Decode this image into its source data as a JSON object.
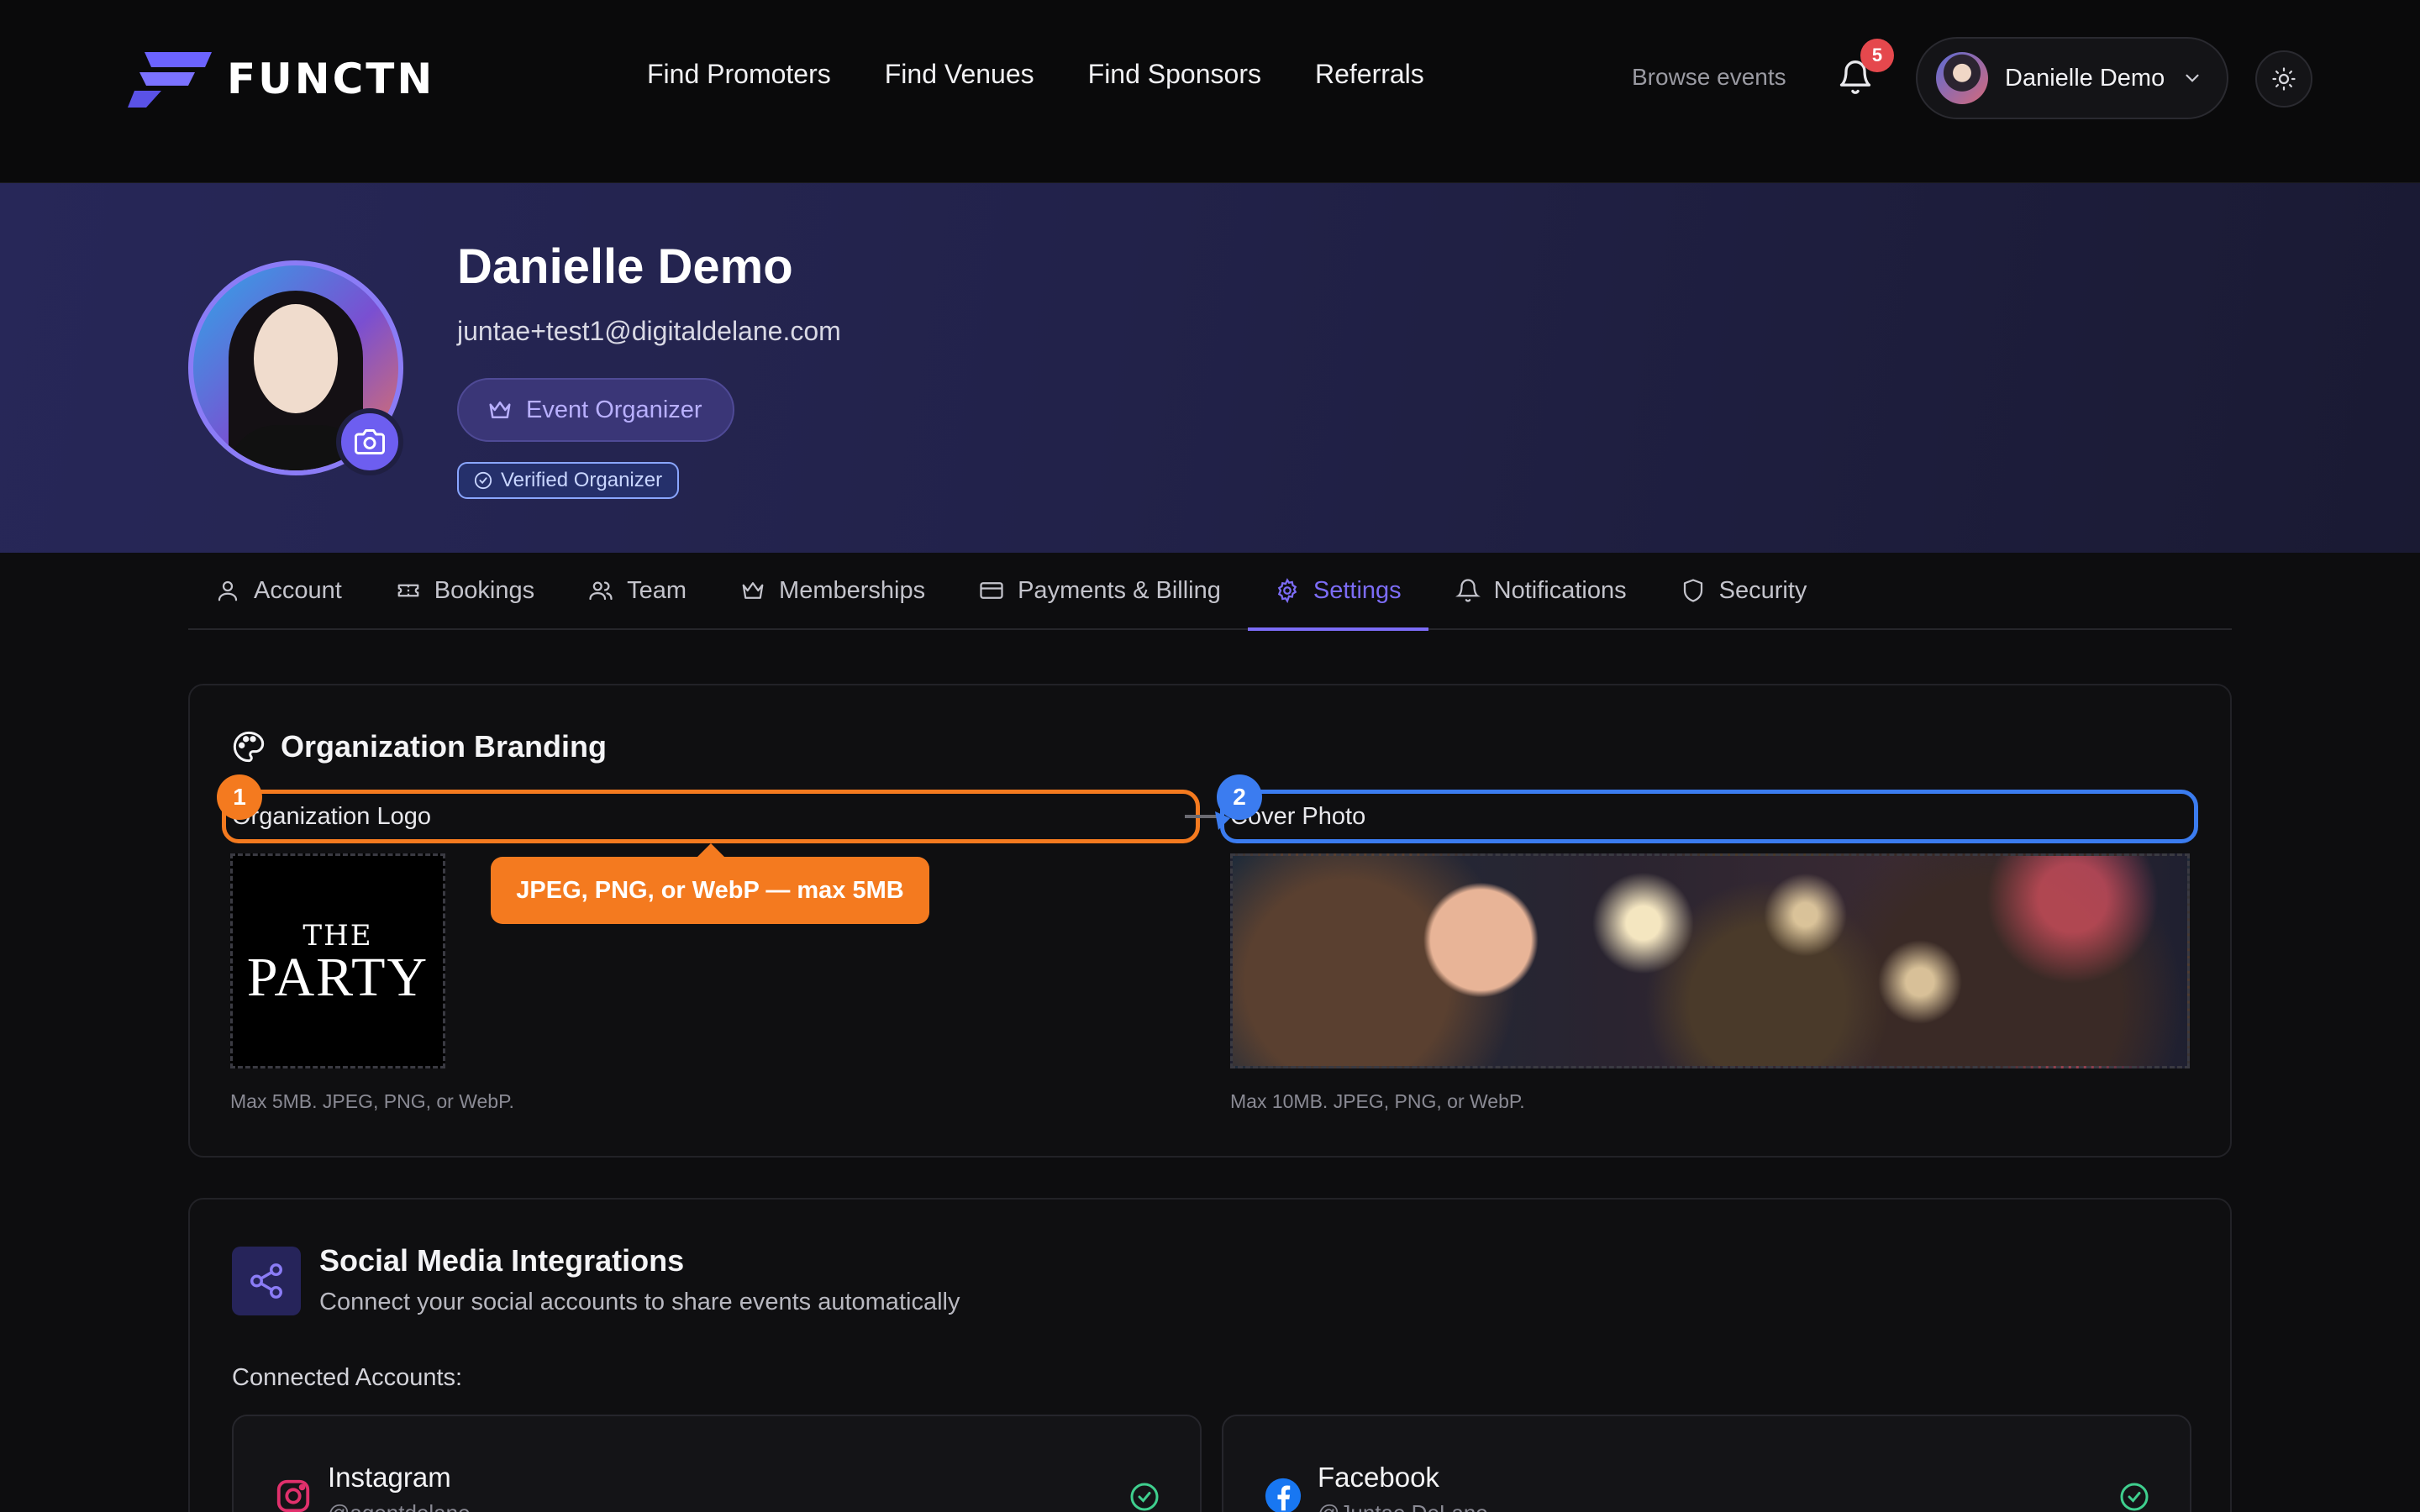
{
  "app": {
    "brand": "FUNCTN"
  },
  "nav": {
    "links": [
      "Find Promoters",
      "Find Venues",
      "Find Sponsors",
      "Referrals"
    ],
    "browse": "Browse events",
    "notification_count": "5",
    "user_name": "Danielle Demo"
  },
  "profile": {
    "name": "Danielle Demo",
    "email": "juntae+test1@digitaldelane.com",
    "role": "Event Organizer",
    "verified": "Verified Organizer"
  },
  "tabs": [
    {
      "label": "Account",
      "icon": "user-icon"
    },
    {
      "label": "Bookings",
      "icon": "ticket-icon"
    },
    {
      "label": "Team",
      "icon": "users-icon"
    },
    {
      "label": "Memberships",
      "icon": "crown-icon"
    },
    {
      "label": "Payments & Billing",
      "icon": "card-icon"
    },
    {
      "label": "Settings",
      "icon": "gear-icon",
      "active": true
    },
    {
      "label": "Notifications",
      "icon": "bell-icon"
    },
    {
      "label": "Security",
      "icon": "shield-icon"
    }
  ],
  "branding": {
    "title": "Organization Branding",
    "logo_label": "Organization Logo",
    "cover_label": "Cover Photo",
    "marker_1": "1",
    "marker_2": "2",
    "tooltip": "JPEG, PNG, or WebP — max 5MB",
    "logo_image_text_top": "THE",
    "logo_image_text_bottom": "PARTY",
    "logo_hint": "Max 5MB. JPEG, PNG, or WebP.",
    "cover_hint": "Max 10MB. JPEG, PNG, or WebP."
  },
  "social": {
    "title": "Social Media Integrations",
    "subtitle": "Connect your social accounts to share events automatically",
    "connected_label": "Connected Accounts:",
    "accounts": [
      {
        "name": "Instagram",
        "handle": "@agentdelane",
        "icon": "instagram-icon"
      },
      {
        "name": "Facebook",
        "handle": "@Juntae DeLane",
        "icon": "facebook-icon"
      }
    ]
  },
  "colors": {
    "accent": "#7c6cf6",
    "highlight_orange": "#f47a1f",
    "highlight_blue": "#3b7cf0",
    "badge_red": "#e5484d",
    "success_green": "#3fcf8e"
  }
}
